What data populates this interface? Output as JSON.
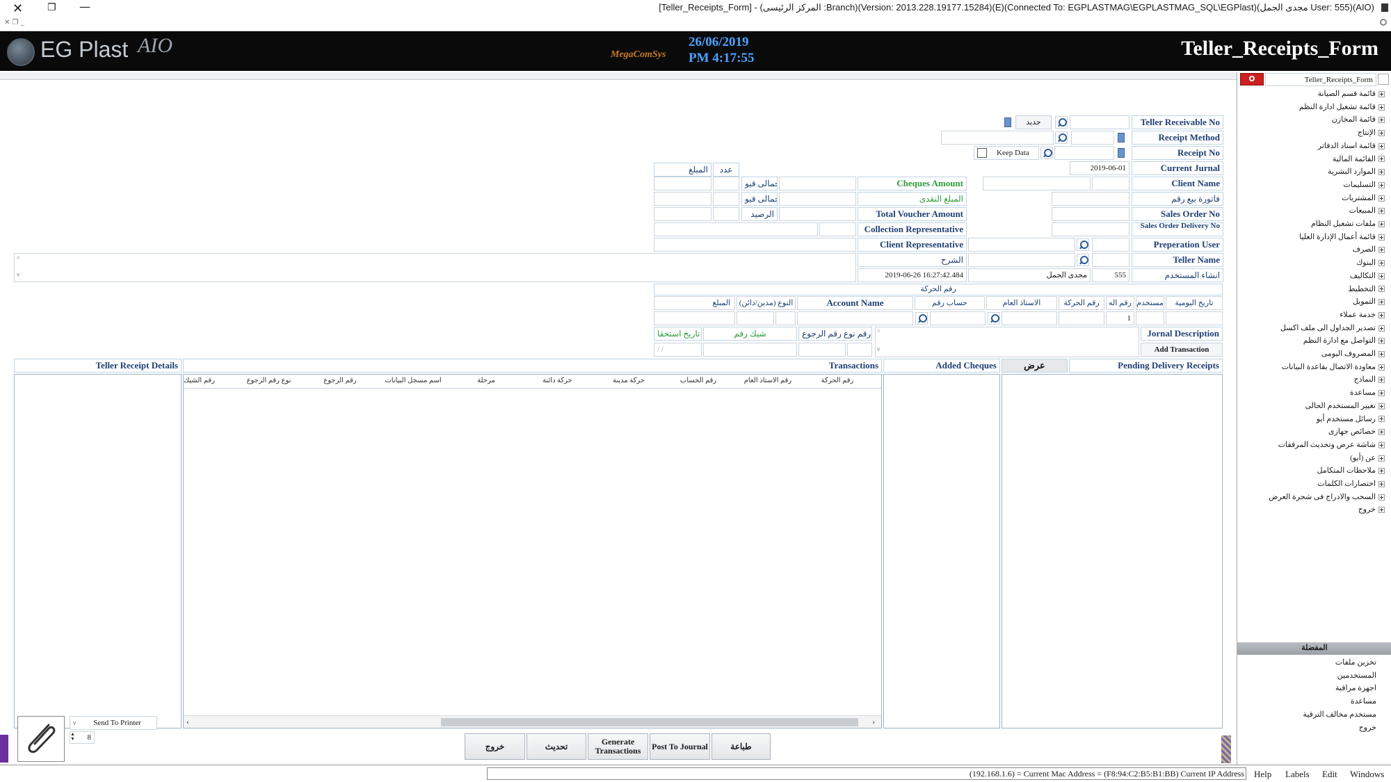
{
  "window": {
    "title": "[Teller_Receipts_Form] - (المركز الرئيسى :Branch)(Version: 2013.228.19177.15284)(E)(Connected To: EGPLASTMAG\\EGPLASTMAG_SQL\\EGPlast)(مجدى الجمل User: 555)(AIO)"
  },
  "header": {
    "logo_text": "EG Plast",
    "logo_suffix": "AIO",
    "brand_mark": "MegaComSys",
    "date": "26/06/2019",
    "time": "PM 4:17:55",
    "form_title": "Teller_Receipts_Form"
  },
  "form": {
    "teller_receivable_no": "Teller Receivable No",
    "new_label": "جديد",
    "receipt_method": "Receipt Method",
    "receipt_no": "Receipt No",
    "keep_data": "Keep Data",
    "current_jurnal": "Current Jurnal",
    "current_jurnal_value": "2019-06-01",
    "client_name": "Client Name",
    "sales_invoice_no": "فاتورة بيع رقم",
    "sales_order_no": "Sales Order No",
    "sales_order_delivery_no": "Sales Order Delivery No",
    "preperation_user": "Preperation User",
    "teller_name": "Teller Name",
    "created_by_user": "انشاء المستخدم",
    "user_code": "555",
    "user_name": "مجدى الجمل",
    "created_at": "2019-06-26 16:27:42.484",
    "cheques_amount": "Cheques Amount",
    "cash_amount": "المبلغ النقدى",
    "total_voucher_amount": "Total Voucher Amount",
    "collection_representative": "Collection Representative",
    "client_representative": "Client Representative",
    "description": "الشرح",
    "summary_count": "عدد",
    "summary_amount": "المبلغ",
    "total_label_1": "إجمالى قيو",
    "total_label_2": "إجمالى قيو",
    "balance": "الرصيد"
  },
  "transaction_entry": {
    "title": "رقم الحركة",
    "columns": [
      "تاريخ اليومية",
      "مستخدم",
      "رقم اله",
      "رقم الحركة",
      "الاستاذ العام",
      "حساب رقم",
      "Account Name",
      "النوع (مدين/دائن)",
      "المبلغ"
    ],
    "row_value": "1",
    "jornal_description": "Jornal Description",
    "add_transaction": "Add Transaction",
    "return_type_no": "رقم نوع رقم الرجوع",
    "cheque_no": "شيك رقم",
    "due_date": "تاريخ استحقا",
    "due_date_placeholder": "/ /"
  },
  "panels": {
    "pending_delivery_receipts": "Pending Delivery Receipts",
    "display": "عرض",
    "added_cheques": "Added Cheques",
    "transactions": "Transactions",
    "teller_receipt_details": "Teller Receipt Details",
    "transaction_columns": [
      "رقم الحركة",
      "رقم الاستاذ العام",
      "رقم الحساب",
      "حركة مدينة",
      "حركة دائنة",
      "مرحلة",
      "اسم مسجل البيانات",
      "رقم الرجوع",
      "نوع رقم الرجوع",
      "رقم الشيك"
    ]
  },
  "bottom": {
    "send_to_printer": "Send To Printer",
    "copies": "8",
    "buttons": {
      "print": "طباعة",
      "post_to_journal": "Post To Journal",
      "generate_transactions": "Generate Transactions",
      "refresh": "تحديث",
      "exit": "خروج"
    }
  },
  "sidebar": {
    "search_value": "Teller_Receipts_Form",
    "tree_items": [
      "قائمة قسم الصيانة",
      "قائمة تشغيل ادارة النظم",
      "قائمة المخازن",
      "الإنتاج",
      "قائمة اسناد الدفاتر",
      "القائمة المالية",
      "الموارد البشرية",
      "التسليمات",
      "المشتريات",
      "المبيعات",
      "ملفات تشغيل النظام",
      "قائمة أعمال الإدارة العليا",
      "الصرف",
      "البنوك",
      "التكاليف",
      "التخطيط",
      "التمويل",
      "خدمة عملاء",
      "تصدير الجداول الى ملف اكسل",
      "التواصل مع ادارة النظم",
      "المصروف اليومى",
      "معاودة الاتصال بقاعدة البيانات",
      "النماذج",
      "مساعدة",
      "تغيير المستخدم الحالى",
      "رسائل مستخدم أيو",
      "خصائص جهازى",
      "شاشة عرض وتحديث المرفقات",
      "عن (أيو)",
      "ملاحظات المتكامل",
      "اختصارات الكلمات",
      "السحب والادراج فى شجرة العرض",
      "خروج"
    ],
    "favorites_title": "المفضلة",
    "favorites": [
      "تخزين ملفات",
      "المستخدمين",
      "اجهزة مراقبة",
      "مساعدة",
      "مستخدم مخالف الترقية",
      "خروج"
    ]
  },
  "statusbar": {
    "info": "(192.168.1.6) = Current Mac Address = (F8:94:C2:B5:B1:BB) Current IP Address",
    "menu": [
      "Help",
      "Labels",
      "Edit",
      "Windows"
    ]
  },
  "colors": {
    "header_bg": "#0a0a0a",
    "date_color": "#4aa3ff",
    "label_color": "#1f3f73",
    "green_label": "#2e9b3a",
    "search_red": "#cc2020"
  }
}
